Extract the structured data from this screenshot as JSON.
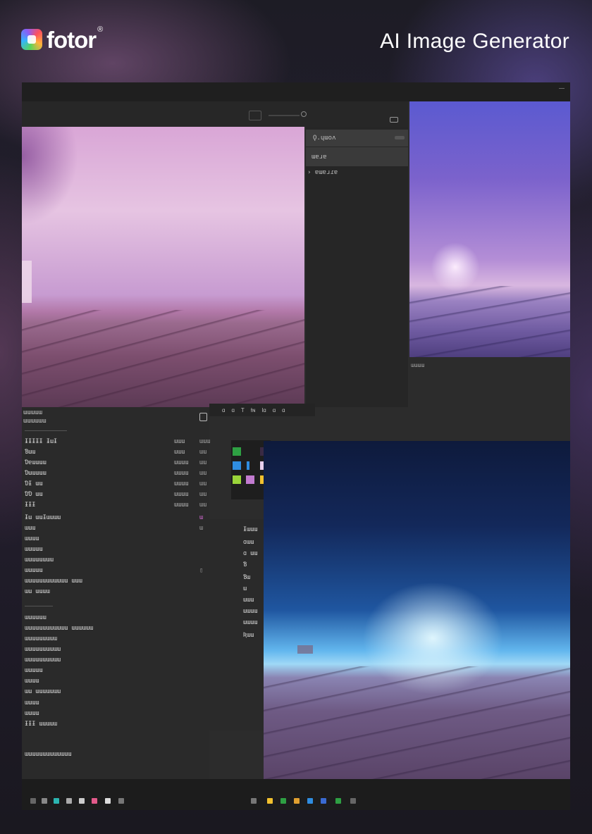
{
  "brand": {
    "name": "fotor",
    "registered": "®",
    "title": "AI Image Generator"
  },
  "colors": {
    "background": "#1d1c25",
    "window": "#2c2c2c",
    "panel_dark": "#1f1f1f",
    "accent_purple": "#c79bd1",
    "accent_blue": "#5b5ad0",
    "sky_blue": "#62b6ee"
  },
  "toolbar": {
    "layers_icon": "frame-icon",
    "zoom_icon": "zoom-icon",
    "link_icon": "link-icon"
  },
  "props": {
    "row1": "Ǫ.ɥɯoʌ",
    "row2": "ɯɐɹɐ",
    "row3": "› ɐɯɐɹɾɐ",
    "right_caption": "ɯɯɯɯ"
  },
  "mid_toolbar": [
    "ɑ",
    "ɑ",
    "T",
    "Ɨɴ",
    "Ɩɑ",
    "ɑ",
    "ɑ"
  ],
  "layers": {
    "header": "ɯɯɯɯɯ",
    "subheader": "ɯɯɯɯɯɯ",
    "rows": [
      {
        "name": "ƗƗƗƗƗ ƗɯƗ",
        "value": "ɯɯɯ",
        "icon": "ɯɯɯ"
      },
      {
        "name": "Ɓɯɯ",
        "value": "ɯɯɯ",
        "icon": "ɯɯ"
      },
      {
        "name": "Ɗɐɯɯɯɯ",
        "value": "ɯɯɯɯ",
        "icon": "ɯɯ"
      },
      {
        "name": "Ɗɯɯɯɯɯ",
        "value": "ɯɯɯɯ",
        "icon": "ɯɯ"
      },
      {
        "name": "ƊƗ ɯɯ",
        "value": "ɯɯɯɯ",
        "icon": "ɯɯ"
      },
      {
        "name": "ƊƊ ɯɯ",
        "value": "ɯɯɯɯ",
        "icon": "ɯɯ"
      },
      {
        "name": "ƗƗƗ",
        "value": "ɯɯɯɯ",
        "icon": "ɯɯ"
      },
      {
        "name": "Ɨɯ ɯɯƗɯɯɯɯ",
        "value": "",
        "icon": "ɯ"
      },
      {
        "name": "ɯɯɯ",
        "value": "",
        "icon": "ɯ"
      },
      {
        "name": "ɯɯɯɯ",
        "value": "",
        "icon": ""
      },
      {
        "name": "ɯɯɯɯɯ",
        "value": "",
        "icon": ""
      },
      {
        "name": "ɯɯɯɯɯɯɯɯ",
        "value": "",
        "icon": ""
      },
      {
        "name": "ɯɯɯɯɯ",
        "value": "",
        "icon": "▯"
      },
      {
        "name": "ɯɯɯɯɯɯɯɯɯɯɯɯ ɯɯɯ",
        "value": "",
        "icon": ""
      },
      {
        "name": "ɯɯ ɯɯɯɯ",
        "value": "",
        "icon": ""
      }
    ],
    "rows2": [
      "ɯɯɯɯɯɯ",
      "ɯɯɯɯɯɯɯɯɯɯɯɯ ɯɯɯɯɯɯ",
      "ɯɯɯɯɯɯɯɯɯ",
      "ɯɯɯɯɯɯɯɯɯɯ",
      "ɯɯɯɯɯɯɯɯɯɯ",
      "ɯɯɯɯɯ",
      "ɯɯɯɯ",
      "ɯɯ ɯɯɯɯɯɯɯ",
      "ɯɯɯɯ",
      "ɯɯɯɯ",
      "ƗƗƗ ɯɯɯɯɯ",
      "ɯɯɯɯɯɯɯɯɯɯɯɯɯ"
    ]
  },
  "right_menu": [
    "Ɨɯɯɯ",
    "ɑɯɯ",
    "ɑ ɯɯ",
    "Ɓ",
    "Ɓɯ",
    "ɯ",
    "ɯɯɯ",
    "ɯɯɯɯ",
    "ɯɯɯɯ",
    "Ʀɯɯ"
  ]
}
